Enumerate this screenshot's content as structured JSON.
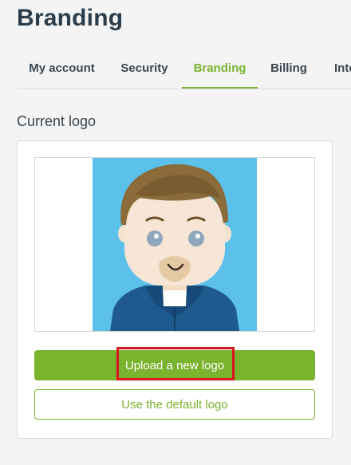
{
  "page": {
    "title": "Branding"
  },
  "tabs": [
    {
      "label": "My account",
      "active": false
    },
    {
      "label": "Security",
      "active": false
    },
    {
      "label": "Branding",
      "active": true
    },
    {
      "label": "Billing",
      "active": false
    },
    {
      "label": "Inte",
      "active": false
    }
  ],
  "current_logo": {
    "section_label": "Current logo",
    "image": "avatar-illustration"
  },
  "actions": {
    "upload_label": "Upload a new logo",
    "default_label": "Use the default logo"
  },
  "colors": {
    "accent": "#7ab32e",
    "title": "#2c3e4c",
    "highlight": "#e0141e",
    "avatar_background": "#5bc0ea"
  }
}
